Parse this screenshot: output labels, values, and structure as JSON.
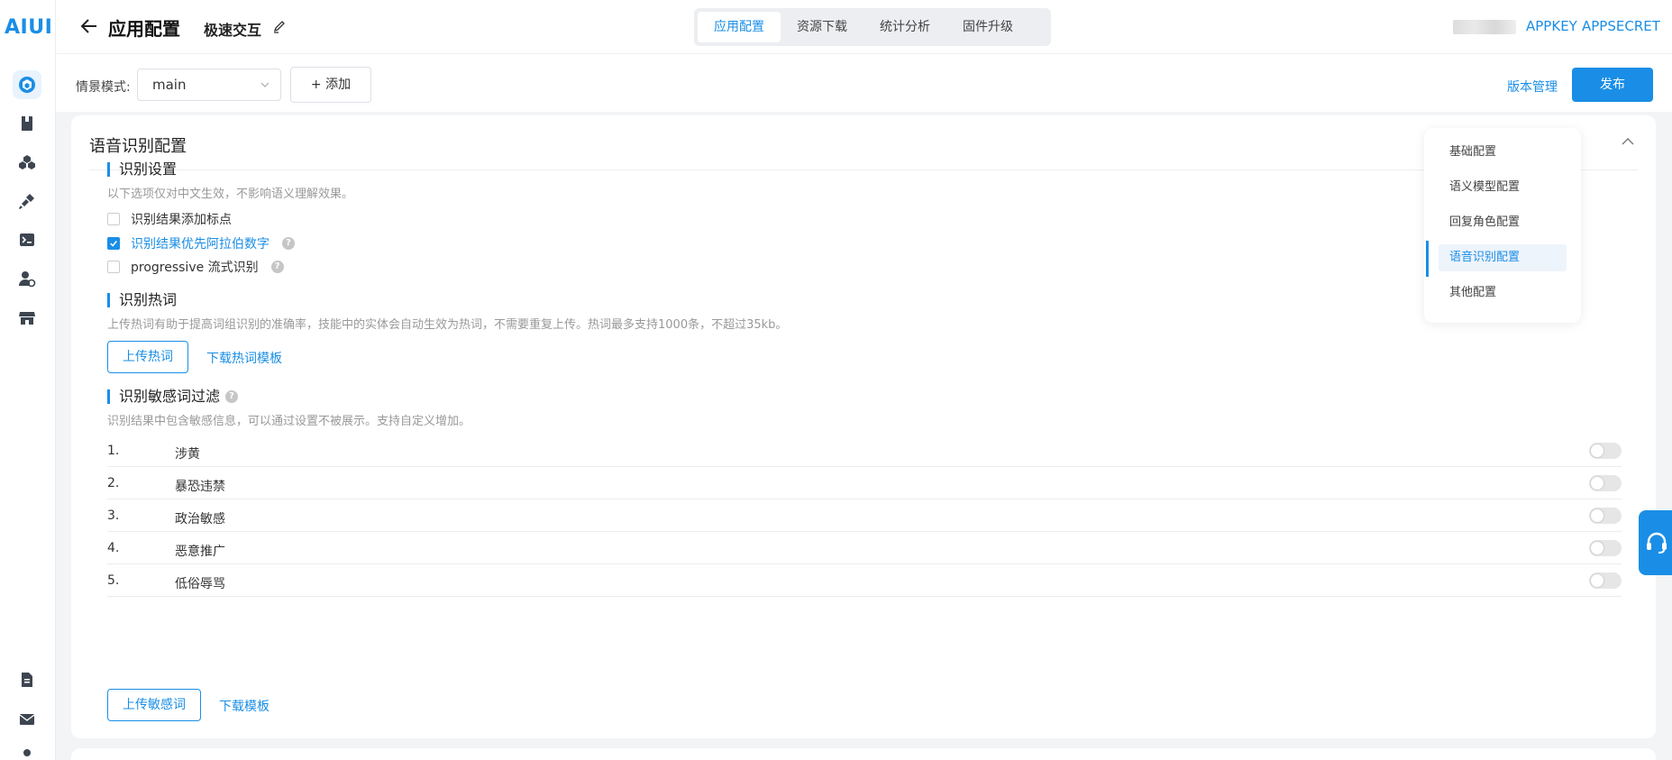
{
  "sidebar": {
    "logo": "AIUI"
  },
  "header": {
    "title": "应用配置",
    "app_name": "极速交互",
    "tabs": [
      {
        "label": "应用配置"
      },
      {
        "label": "资源下载"
      },
      {
        "label": "统计分析"
      },
      {
        "label": "固件升级"
      }
    ],
    "appkey": "APPKEY",
    "appsecret": "APPSECRET"
  },
  "toolbar": {
    "scene_label": "情景模式:",
    "scene_value": "main",
    "add_label": "+ 添加",
    "version_label": "版本管理",
    "publish_label": "发布"
  },
  "card": {
    "title": "语音识别配置",
    "recognition": {
      "title": "识别设置",
      "hint": "以下选项仅对中文生效，不影响语义理解效果。",
      "options": [
        {
          "label": "识别结果添加标点",
          "checked": false
        },
        {
          "label": "识别结果优先阿拉伯数字",
          "checked": true
        },
        {
          "label": "progressive 流式识别",
          "checked": false
        }
      ]
    },
    "hotwords": {
      "title": "识别热词",
      "hint": "上传热词有助于提高词组识别的准确率，技能中的实体会自动生效为热词，不需要重复上传。热词最多支持1000条，不超过35kb。",
      "upload_label": "上传热词",
      "download_label": "下载热词模板"
    },
    "sensitive": {
      "title": "识别敏感词过滤",
      "hint": "识别结果中包含敏感信息，可以通过设置不被展示。支持自定义增加。",
      "items": [
        {
          "num": "1.",
          "name": "涉黄",
          "enabled": false
        },
        {
          "num": "2.",
          "name": "暴恐违禁",
          "enabled": false
        },
        {
          "num": "3.",
          "name": "政治敏感",
          "enabled": false
        },
        {
          "num": "4.",
          "name": "恶意推广",
          "enabled": false
        },
        {
          "num": "5.",
          "name": "低俗辱骂",
          "enabled": false
        }
      ],
      "upload_label": "上传敏感词",
      "download_label": "下载模板"
    }
  },
  "anchor_nav": {
    "items": [
      {
        "label": "基础配置"
      },
      {
        "label": "语义模型配置"
      },
      {
        "label": "回复角色配置"
      },
      {
        "label": "语音识别配置",
        "active": true
      },
      {
        "label": "其他配置"
      }
    ]
  },
  "colors": {
    "accent": "#1a8ee6"
  }
}
